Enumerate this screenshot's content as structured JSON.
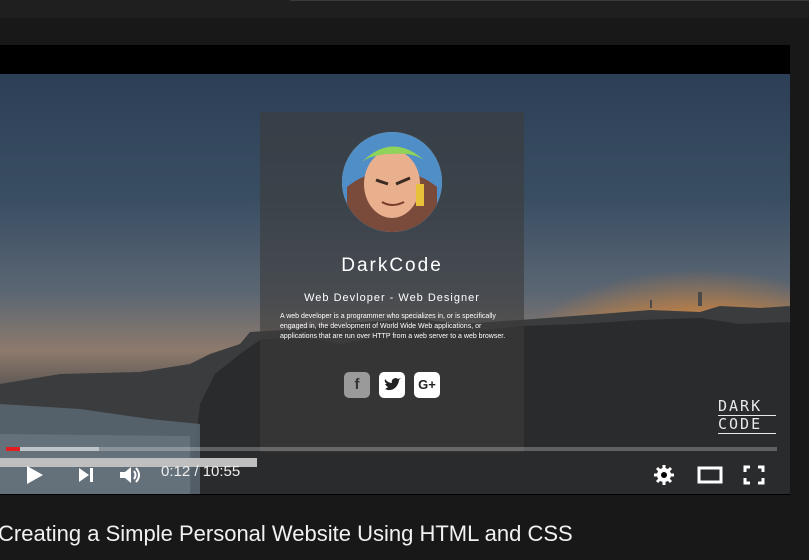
{
  "profile_card": {
    "name": "DarkCode",
    "role": "Web Devloper - Web Designer",
    "description": "A web developer is a programmer who specializes in, or is specifically engaged in, the development of World Wide Web applications, or applications that are run over HTTP from a web server to a web browser.",
    "social_icons": [
      "facebook-icon",
      "twitter-icon",
      "google-plus-icon"
    ]
  },
  "watermark": {
    "line1": "DARK",
    "line2": "CODE"
  },
  "player": {
    "current_time": "0:12",
    "duration": "10:55",
    "time_display": "0:12 / 10:55",
    "played_fraction": 0.018,
    "buffered_fraction": 0.12,
    "icons": [
      "play-icon",
      "next-icon",
      "volume-icon",
      "settings-icon",
      "theater-mode-icon",
      "fullscreen-icon"
    ],
    "accent_color": "#e41e1e"
  },
  "video_title": "Creating a Simple Personal Website Using HTML and CSS"
}
